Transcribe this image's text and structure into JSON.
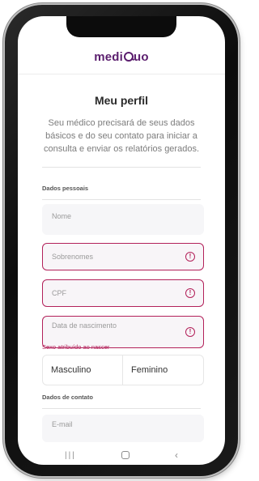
{
  "app": {
    "logo_text_before": "medi",
    "logo_text_after": "uo",
    "logo_color": "#5b1e6e"
  },
  "page": {
    "title": "Meu perfil",
    "subtitle": "Seu médico precisará de seus dados básicos e do seu contato para iniciar a consulta e enviar os relatórios gerados."
  },
  "sections": {
    "personal": "Dados pessoais",
    "contact": "Dados de contato"
  },
  "fields": {
    "name_placeholder": "Nome",
    "surname_placeholder": "Sobrenomes",
    "cpf_placeholder": "CPF",
    "birth_placeholder": "Data de nascimento",
    "email_placeholder": "E-mail"
  },
  "sex": {
    "label": "Sexo atribuído ao nascer",
    "options": [
      "Masculino",
      "Feminino"
    ]
  },
  "colors": {
    "error": "#b3215a",
    "field_bg": "#f6f6f8"
  },
  "icons": {
    "error": "exclamation-circle-icon",
    "nav_recents": "recents-icon",
    "nav_home": "home-icon",
    "nav_back": "back-icon"
  },
  "glyphs": {
    "error": "!",
    "recents": "|||",
    "back": "‹"
  }
}
